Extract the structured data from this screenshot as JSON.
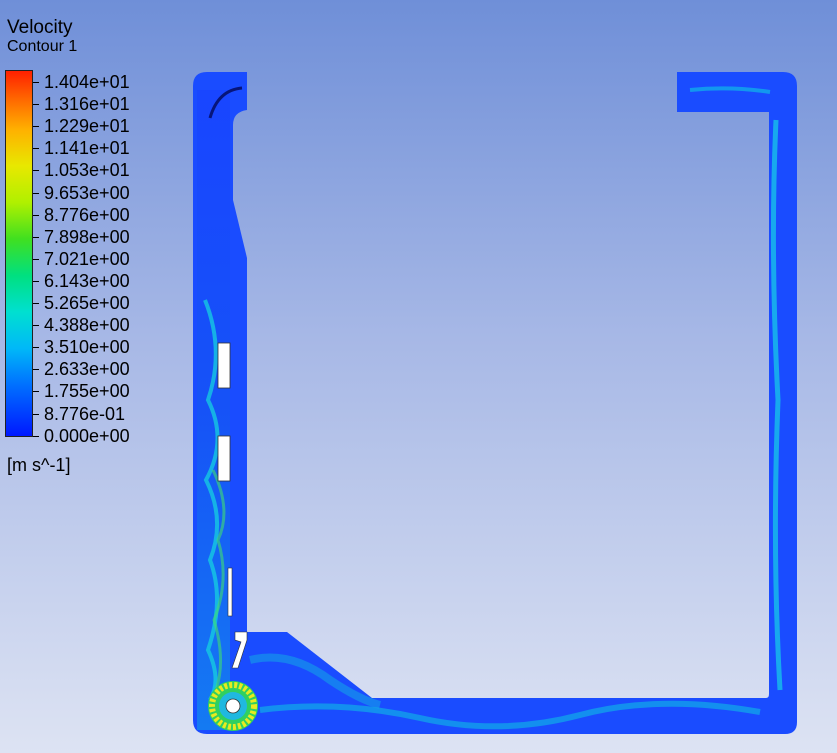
{
  "legend": {
    "title": "Velocity",
    "subtitle": "Contour 1",
    "units": "[m s^-1]",
    "labels": [
      "1.404e+01",
      "1.316e+01",
      "1.229e+01",
      "1.141e+01",
      "1.053e+01",
      "9.653e+00",
      "8.776e+00",
      "7.898e+00",
      "7.021e+00",
      "6.143e+00",
      "5.265e+00",
      "4.388e+00",
      "3.510e+00",
      "2.633e+00",
      "1.755e+00",
      "8.776e-01",
      "0.000e+00"
    ]
  },
  "colors": {
    "fluid": "#1a4cff",
    "jet": "#12c8e8",
    "high": "#e8ea20",
    "rotor": "#ffffff"
  }
}
